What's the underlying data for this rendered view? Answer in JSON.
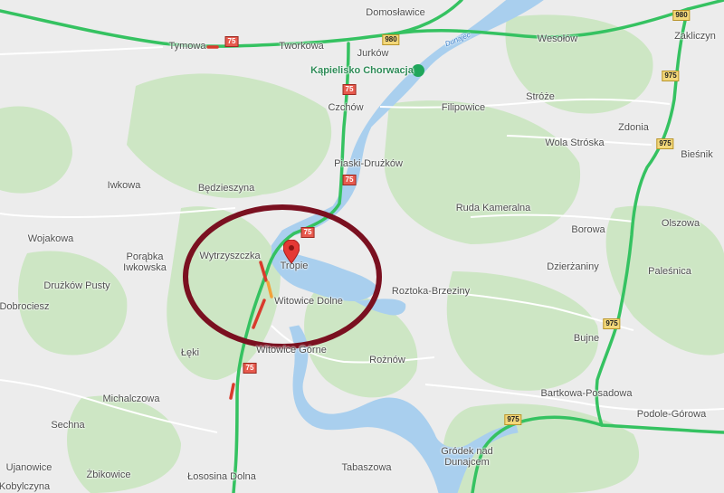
{
  "places": [
    {
      "id": "domoslawice",
      "name": "Domosławice"
    },
    {
      "id": "tymowa",
      "name": "Tymowa"
    },
    {
      "id": "tworkowa",
      "name": "Tworkowa"
    },
    {
      "id": "jurkow",
      "name": "Jurków"
    },
    {
      "id": "wesolow",
      "name": "Wesołów"
    },
    {
      "id": "zakliczyn",
      "name": "Zakliczyn"
    },
    {
      "id": "kapielisko",
      "name": "Kąpielisko Chorwacja",
      "poi": true
    },
    {
      "id": "czchow",
      "name": "Czchów"
    },
    {
      "id": "filipowice",
      "name": "Filipowice"
    },
    {
      "id": "stroze",
      "name": "Stróże"
    },
    {
      "id": "zdonia",
      "name": "Zdonia"
    },
    {
      "id": "wolastroska",
      "name": "Wola Stróska"
    },
    {
      "id": "biesnik",
      "name": "Bieśnik"
    },
    {
      "id": "piaski",
      "name": "Piaski-Drużków"
    },
    {
      "id": "iwkowa",
      "name": "Iwkowa"
    },
    {
      "id": "bedzieszyna",
      "name": "Będzieszyna"
    },
    {
      "id": "ruda",
      "name": "Ruda Kameralna"
    },
    {
      "id": "borowa",
      "name": "Borowa"
    },
    {
      "id": "olszowa",
      "name": "Olszowa"
    },
    {
      "id": "wojakowa",
      "name": "Wojakowa"
    },
    {
      "id": "porabka",
      "name": "Porąbka Iwkowska"
    },
    {
      "id": "wytrzyszczka",
      "name": "Wytrzyszczka"
    },
    {
      "id": "tropie",
      "name": "Tropie"
    },
    {
      "id": "dzierzaniny",
      "name": "Dzierżaniny"
    },
    {
      "id": "palesnica",
      "name": "Paleśnica"
    },
    {
      "id": "druzkow",
      "name": "Drużków Pusty"
    },
    {
      "id": "dobrociesz",
      "name": "Dobrociesz"
    },
    {
      "id": "witowice_d",
      "name": "Witowice Dolne"
    },
    {
      "id": "roztoka",
      "name": "Roztoka-Brzeziny"
    },
    {
      "id": "bujne",
      "name": "Bujne"
    },
    {
      "id": "leki",
      "name": "Łęki"
    },
    {
      "id": "witowice_g",
      "name": "Witowice Górne"
    },
    {
      "id": "roznow",
      "name": "Rożnów"
    },
    {
      "id": "michalczowa",
      "name": "Michalczowa"
    },
    {
      "id": "bartkowa",
      "name": "Bartkowa-Posadowa"
    },
    {
      "id": "podole",
      "name": "Podole-Górowa"
    },
    {
      "id": "sechna",
      "name": "Sechna"
    },
    {
      "id": "grodek",
      "name": "Gródek nad Dunajcem"
    },
    {
      "id": "ujanowice",
      "name": "Ujanowice"
    },
    {
      "id": "zbikowice",
      "name": "Żbikowice"
    },
    {
      "id": "tabaszowa",
      "name": "Tabaszowa"
    },
    {
      "id": "lososina",
      "name": "Łososina Dolna"
    },
    {
      "id": "kobylczyna",
      "name": "Kobylczyna"
    }
  ],
  "river_label": "Dunajec",
  "road_shields": [
    {
      "id": "r75a",
      "num": "75",
      "type": "red"
    },
    {
      "id": "r980a",
      "num": "980",
      "type": "yellow"
    },
    {
      "id": "r980b",
      "num": "980",
      "type": "yellow"
    },
    {
      "id": "r75b",
      "num": "75",
      "type": "red"
    },
    {
      "id": "r975a",
      "num": "975",
      "type": "yellow"
    },
    {
      "id": "r975b",
      "num": "975",
      "type": "yellow"
    },
    {
      "id": "r75c",
      "num": "75",
      "type": "red"
    },
    {
      "id": "r75d",
      "num": "75",
      "type": "red"
    },
    {
      "id": "r975c",
      "num": "975",
      "type": "yellow"
    },
    {
      "id": "r975d",
      "num": "975",
      "type": "yellow"
    },
    {
      "id": "r75e",
      "num": "75",
      "type": "red"
    }
  ],
  "colors": {
    "land": "#ececec",
    "forest": "#cde6c4",
    "water": "#a9cfee",
    "road_free": "#35c261",
    "road_jam": "#d93b2d",
    "annotation": "#7a1020",
    "pin": "#e53935"
  }
}
